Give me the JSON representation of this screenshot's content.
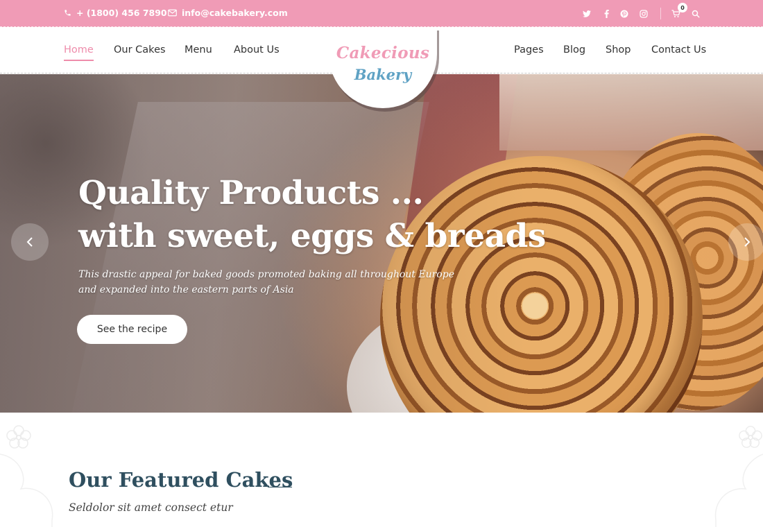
{
  "topbar": {
    "phone": "+ (1800) 456 7890",
    "email": "info@cakebakery.com",
    "cart_count": "0",
    "social_icons": [
      "twitter-icon",
      "facebook-icon",
      "pinterest-icon",
      "instagram-icon"
    ]
  },
  "nav": {
    "left_items": [
      "Home",
      "Our Cakes",
      "Menu",
      "About Us"
    ],
    "right_items": [
      "Pages",
      "Blog",
      "Shop",
      "Contact Us"
    ],
    "active": "Home"
  },
  "logo": {
    "line1": "Cakecious",
    "line2": "Bakery"
  },
  "hero": {
    "title_line1": "Quality Products ...",
    "title_line2": "with sweet, eggs & breads",
    "subtitle_line1": "This drastic appeal for baked goods promoted baking all throughout Europe",
    "subtitle_line2": "and expanded into the eastern parts of Asia",
    "button_label": "See the recipe"
  },
  "featured": {
    "title": "Our Featured Cakes",
    "subtitle": "Seldolor sit amet consect etur"
  },
  "colors": {
    "brand_pink": "#f09bb6",
    "accent_pink": "#ee8cab",
    "brand_blue": "#5fa2c4",
    "heading_dark": "#2f4f5f"
  }
}
